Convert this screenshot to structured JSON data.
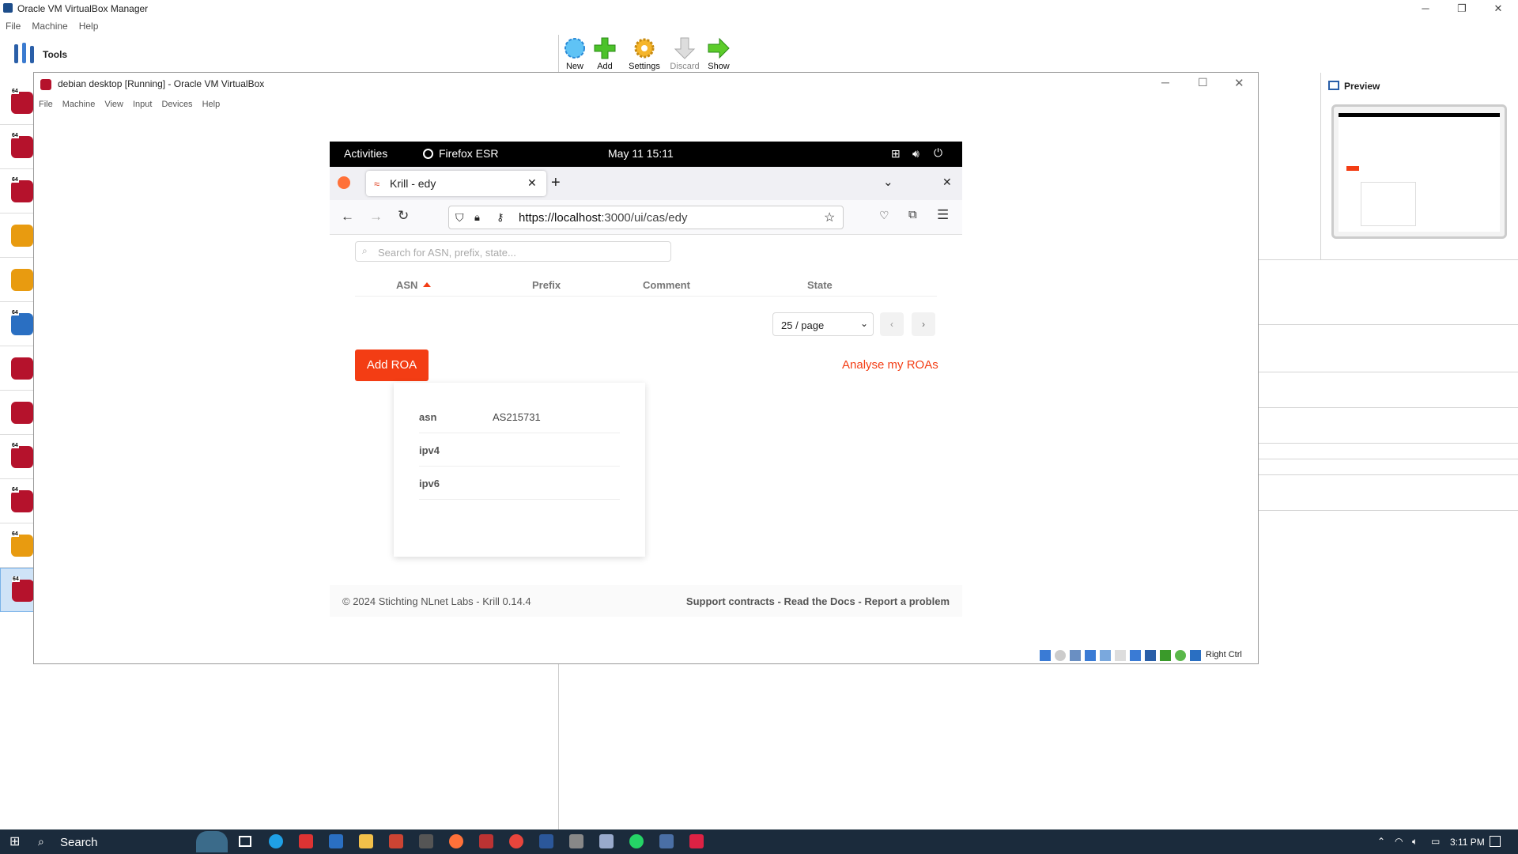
{
  "manager": {
    "title": "Oracle VM VirtualBox Manager",
    "menu": [
      "File",
      "Machine",
      "Help"
    ],
    "tools_label": "Tools",
    "toolbar": [
      "New",
      "Add",
      "Settings",
      "Discard",
      "Show"
    ],
    "vm_badge": "64",
    "preview_label": "Preview"
  },
  "vm_window": {
    "title": "debian desktop [Running] - Oracle VM VirtualBox",
    "menu": [
      "File",
      "Machine",
      "View",
      "Input",
      "Devices",
      "Help"
    ],
    "host_key": "Right Ctrl"
  },
  "gnome": {
    "activities": "Activities",
    "app": "Firefox ESR",
    "clock": "May 11  15:11"
  },
  "firefox": {
    "tab_title": "Krill - edy",
    "url_host": "https://localhost",
    "url_path": ":3000/ui/cas/edy"
  },
  "krill": {
    "search_placeholder": "Search for ASN, prefix, state...",
    "columns": [
      "ASN",
      "Prefix",
      "Comment",
      "State"
    ],
    "page_size": "25 / page",
    "add_roa": "Add ROA",
    "analyse": "Analyse my ROAs",
    "popup_rows": [
      {
        "label": "asn",
        "value": "AS215731"
      },
      {
        "label": "ipv4",
        "value": ""
      },
      {
        "label": "ipv6",
        "value": ""
      }
    ],
    "footer_left": "© 2024 Stichting NLnet Labs - Krill 0.14.4",
    "footer_links": [
      "Support contracts",
      "Read the Docs",
      "Report a problem"
    ],
    "footer_sep": "-"
  },
  "taskbar": {
    "search": "Search",
    "time": "3:11 PM"
  },
  "colors": {
    "accent": "#f33d14",
    "taskbar": "#1b2b3c"
  }
}
